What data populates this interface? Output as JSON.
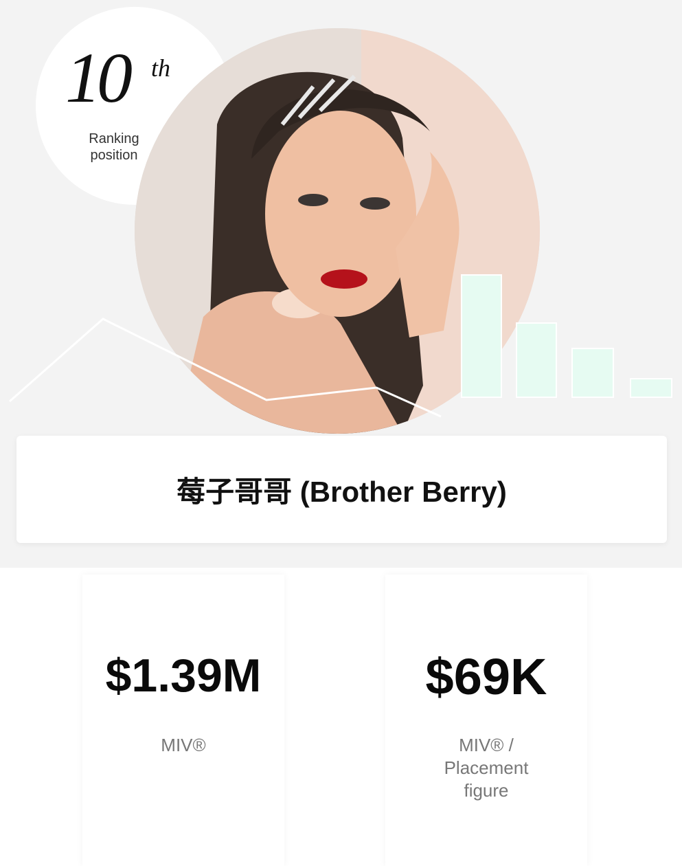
{
  "ranking": {
    "number": "10",
    "suffix": "th",
    "label": "Ranking position"
  },
  "portrait": {
    "icon": "influencer-portrait"
  },
  "influencer": {
    "name": "莓子哥哥 (Brother Berry)"
  },
  "stats": [
    {
      "value": "$1.39M",
      "label": "MIV®"
    },
    {
      "value": "$69K",
      "label": "MIV® / Placement figure"
    }
  ],
  "colors": {
    "hero_background": "#f3f3f3",
    "bar_mint": "#e6fbf2",
    "line_white": "#ffffff",
    "text_dark": "#111111",
    "label_gray": "#777777"
  }
}
